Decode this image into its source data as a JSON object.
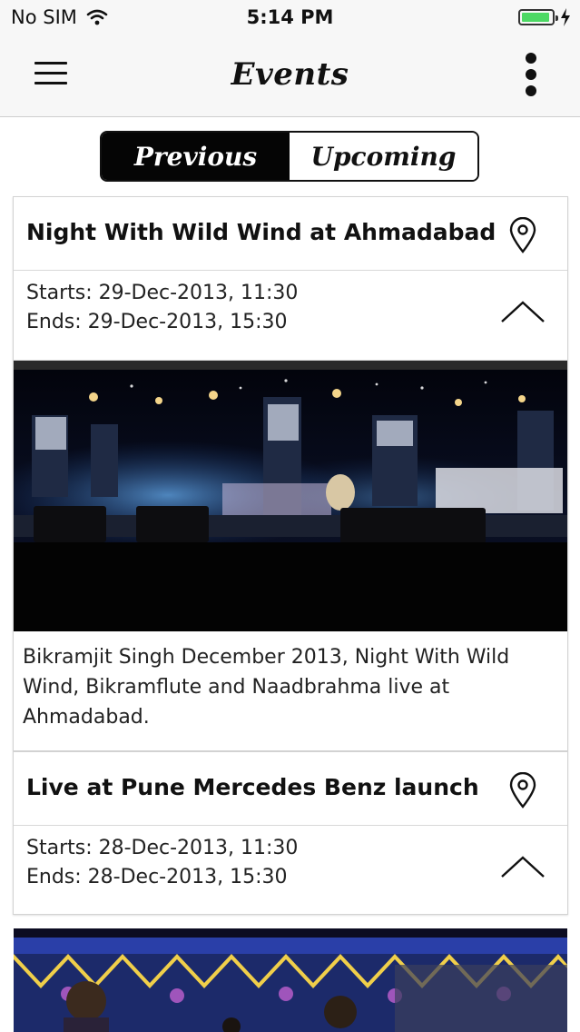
{
  "status_bar": {
    "carrier": "No SIM",
    "time": "5:14 PM"
  },
  "nav": {
    "title": "Events",
    "menu_icon": "hamburger-menu-icon",
    "more_icon": "vertical-dots-icon"
  },
  "segments": {
    "previous": "Previous",
    "upcoming": "Upcoming",
    "selected": "Previous"
  },
  "events": [
    {
      "title": "Night With Wild Wind at Ahmadabad",
      "starts": "Starts: 29-Dec-2013, 11:30",
      "ends": "Ends: 29-Dec-2013, 15:30",
      "description": "Bikramjit Singh December 2013, Night With Wild Wind, Bikramflute and Naadbrahma live at Ahmadabad."
    },
    {
      "title": "Live at Pune Mercedes Benz launch",
      "starts": "Starts: 28-Dec-2013, 11:30",
      "ends": "Ends: 28-Dec-2013, 15:30"
    }
  ],
  "colors": {
    "bar_bg": "#f7f7f7",
    "segment_active": "#050505",
    "battery": "#4cd964"
  }
}
